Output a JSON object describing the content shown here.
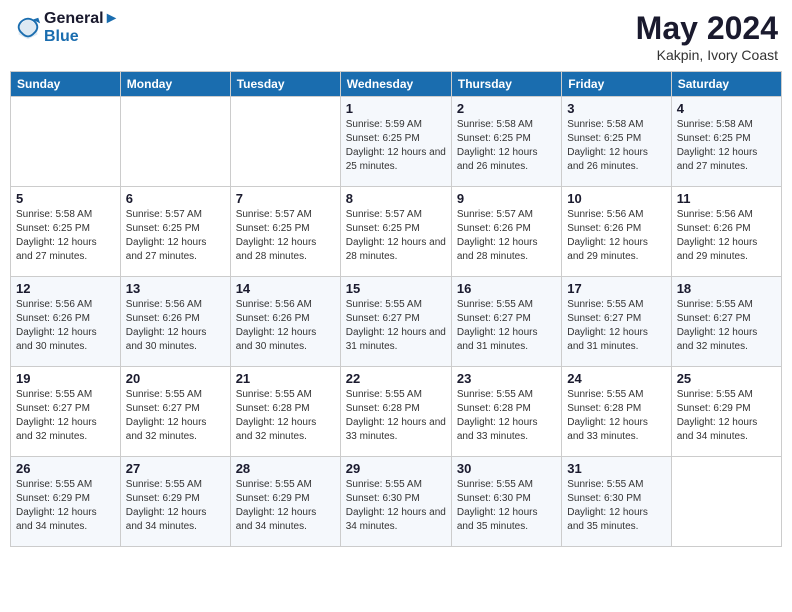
{
  "header": {
    "logo_line1": "General",
    "logo_line2": "Blue",
    "month_year": "May 2024",
    "location": "Kakpin, Ivory Coast"
  },
  "days_of_week": [
    "Sunday",
    "Monday",
    "Tuesday",
    "Wednesday",
    "Thursday",
    "Friday",
    "Saturday"
  ],
  "weeks": [
    [
      {
        "day": "",
        "info": ""
      },
      {
        "day": "",
        "info": ""
      },
      {
        "day": "",
        "info": ""
      },
      {
        "day": "1",
        "info": "Sunrise: 5:59 AM\nSunset: 6:25 PM\nDaylight: 12 hours and 25 minutes."
      },
      {
        "day": "2",
        "info": "Sunrise: 5:58 AM\nSunset: 6:25 PM\nDaylight: 12 hours and 26 minutes."
      },
      {
        "day": "3",
        "info": "Sunrise: 5:58 AM\nSunset: 6:25 PM\nDaylight: 12 hours and 26 minutes."
      },
      {
        "day": "4",
        "info": "Sunrise: 5:58 AM\nSunset: 6:25 PM\nDaylight: 12 hours and 27 minutes."
      }
    ],
    [
      {
        "day": "5",
        "info": "Sunrise: 5:58 AM\nSunset: 6:25 PM\nDaylight: 12 hours and 27 minutes."
      },
      {
        "day": "6",
        "info": "Sunrise: 5:57 AM\nSunset: 6:25 PM\nDaylight: 12 hours and 27 minutes."
      },
      {
        "day": "7",
        "info": "Sunrise: 5:57 AM\nSunset: 6:25 PM\nDaylight: 12 hours and 28 minutes."
      },
      {
        "day": "8",
        "info": "Sunrise: 5:57 AM\nSunset: 6:25 PM\nDaylight: 12 hours and 28 minutes."
      },
      {
        "day": "9",
        "info": "Sunrise: 5:57 AM\nSunset: 6:26 PM\nDaylight: 12 hours and 28 minutes."
      },
      {
        "day": "10",
        "info": "Sunrise: 5:56 AM\nSunset: 6:26 PM\nDaylight: 12 hours and 29 minutes."
      },
      {
        "day": "11",
        "info": "Sunrise: 5:56 AM\nSunset: 6:26 PM\nDaylight: 12 hours and 29 minutes."
      }
    ],
    [
      {
        "day": "12",
        "info": "Sunrise: 5:56 AM\nSunset: 6:26 PM\nDaylight: 12 hours and 30 minutes."
      },
      {
        "day": "13",
        "info": "Sunrise: 5:56 AM\nSunset: 6:26 PM\nDaylight: 12 hours and 30 minutes."
      },
      {
        "day": "14",
        "info": "Sunrise: 5:56 AM\nSunset: 6:26 PM\nDaylight: 12 hours and 30 minutes."
      },
      {
        "day": "15",
        "info": "Sunrise: 5:55 AM\nSunset: 6:27 PM\nDaylight: 12 hours and 31 minutes."
      },
      {
        "day": "16",
        "info": "Sunrise: 5:55 AM\nSunset: 6:27 PM\nDaylight: 12 hours and 31 minutes."
      },
      {
        "day": "17",
        "info": "Sunrise: 5:55 AM\nSunset: 6:27 PM\nDaylight: 12 hours and 31 minutes."
      },
      {
        "day": "18",
        "info": "Sunrise: 5:55 AM\nSunset: 6:27 PM\nDaylight: 12 hours and 32 minutes."
      }
    ],
    [
      {
        "day": "19",
        "info": "Sunrise: 5:55 AM\nSunset: 6:27 PM\nDaylight: 12 hours and 32 minutes."
      },
      {
        "day": "20",
        "info": "Sunrise: 5:55 AM\nSunset: 6:27 PM\nDaylight: 12 hours and 32 minutes."
      },
      {
        "day": "21",
        "info": "Sunrise: 5:55 AM\nSunset: 6:28 PM\nDaylight: 12 hours and 32 minutes."
      },
      {
        "day": "22",
        "info": "Sunrise: 5:55 AM\nSunset: 6:28 PM\nDaylight: 12 hours and 33 minutes."
      },
      {
        "day": "23",
        "info": "Sunrise: 5:55 AM\nSunset: 6:28 PM\nDaylight: 12 hours and 33 minutes."
      },
      {
        "day": "24",
        "info": "Sunrise: 5:55 AM\nSunset: 6:28 PM\nDaylight: 12 hours and 33 minutes."
      },
      {
        "day": "25",
        "info": "Sunrise: 5:55 AM\nSunset: 6:29 PM\nDaylight: 12 hours and 34 minutes."
      }
    ],
    [
      {
        "day": "26",
        "info": "Sunrise: 5:55 AM\nSunset: 6:29 PM\nDaylight: 12 hours and 34 minutes."
      },
      {
        "day": "27",
        "info": "Sunrise: 5:55 AM\nSunset: 6:29 PM\nDaylight: 12 hours and 34 minutes."
      },
      {
        "day": "28",
        "info": "Sunrise: 5:55 AM\nSunset: 6:29 PM\nDaylight: 12 hours and 34 minutes."
      },
      {
        "day": "29",
        "info": "Sunrise: 5:55 AM\nSunset: 6:30 PM\nDaylight: 12 hours and 34 minutes."
      },
      {
        "day": "30",
        "info": "Sunrise: 5:55 AM\nSunset: 6:30 PM\nDaylight: 12 hours and 35 minutes."
      },
      {
        "day": "31",
        "info": "Sunrise: 5:55 AM\nSunset: 6:30 PM\nDaylight: 12 hours and 35 minutes."
      },
      {
        "day": "",
        "info": ""
      }
    ]
  ]
}
